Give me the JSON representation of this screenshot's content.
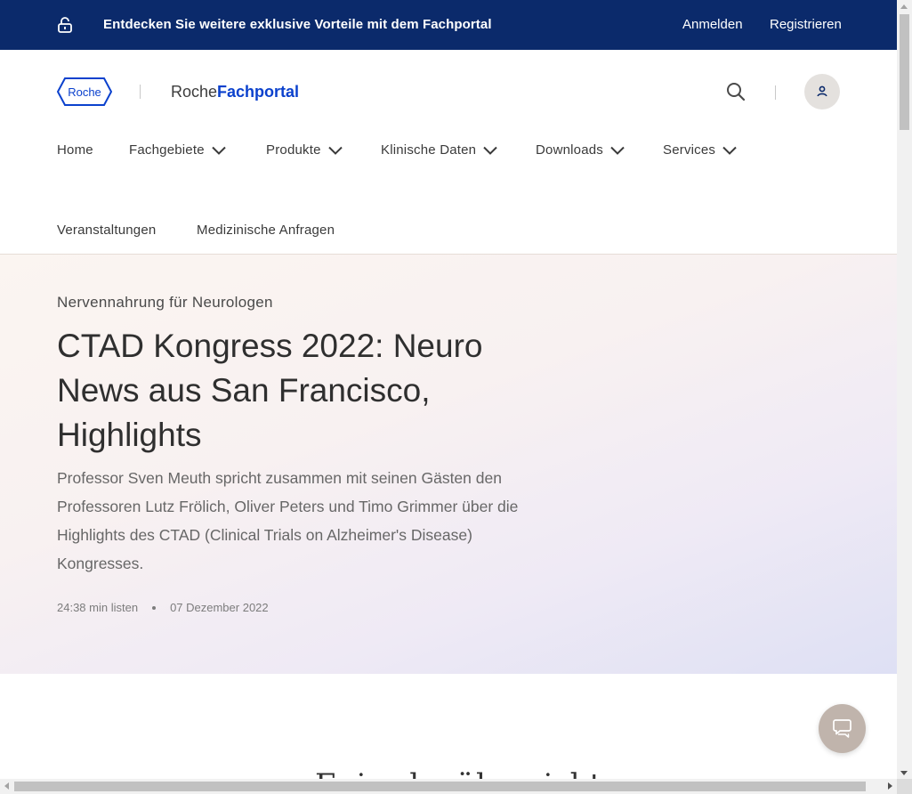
{
  "banner": {
    "promo_text": "Entdecken Sie weitere exklusive Vorteile mit dem Fachportal",
    "login_label": "Anmelden",
    "register_label": "Registrieren",
    "background_color": "#0b2a6b"
  },
  "header": {
    "logo_text": "Roche",
    "brand_prefix": "Roche",
    "brand_suffix": "Fachportal",
    "brand_color": "#0b41cd"
  },
  "nav": {
    "home": "Home",
    "fachgebiete": "Fachgebiete",
    "produkte": "Produkte",
    "klinische_daten": "Klinische Daten",
    "downloads": "Downloads",
    "services": "Services",
    "veranstaltungen": "Veranstaltungen",
    "medizinische_anfragen": "Medizinische Anfragen"
  },
  "hero": {
    "eyebrow": "Nervennahrung für Neurologen",
    "title": "CTAD Kongress 2022: Neuro News aus San Francisco, Highlights",
    "description": "Professor Sven Meuth spricht zusammen mit seinen Gästen den Professoren Lutz Frölich, Oliver Peters und Timo Grimmer über die Highlights des CTAD (Clinical Trials on Alzheimer's Disease) Kongresses.",
    "duration": "24:38 min listen",
    "date": "07 Dezember 2022"
  },
  "section": {
    "partial_heading": "Episodenübersicht"
  },
  "icons": {
    "lock": "lock-open-icon",
    "search": "search-icon",
    "user": "user-icon",
    "chat": "chat-icon",
    "chevron": "chevron-down-icon"
  }
}
